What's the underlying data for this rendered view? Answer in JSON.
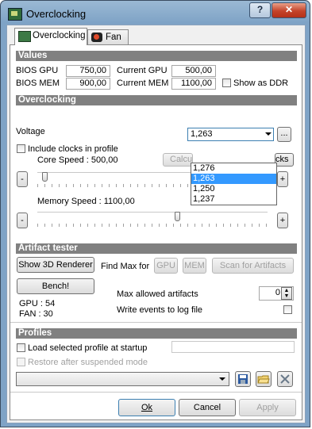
{
  "window": {
    "title": "Overclocking",
    "help_label": "?",
    "close_label": "✕"
  },
  "tabs": [
    {
      "label": "Overclocking",
      "icon": "board-icon"
    },
    {
      "label": "Fan",
      "icon": "fan-icon"
    }
  ],
  "values": {
    "header": "Values",
    "bios_gpu_label": "BIOS GPU",
    "bios_gpu": "750,00",
    "current_gpu_label": "Current GPU",
    "current_gpu": "500,00",
    "bios_mem_label": "BIOS MEM",
    "bios_mem": "900,00",
    "current_mem_label": "Current MEM",
    "current_mem": "1100,00",
    "show_ddr_label": "Show as DDR"
  },
  "overclocking": {
    "header": "Overclocking",
    "voltage_label": "Voltage",
    "voltage_value": "1,263",
    "voltage_options": [
      "1,276",
      "1,263",
      "1,250",
      "1,237"
    ],
    "voltage_more": "...",
    "include_clocks_label": "Include clocks in profile",
    "core_speed_label": "Core Speed : 500,00",
    "calc_button_partial": "Calcu",
    "clocks_button_partial": "cks",
    "minus": "-",
    "plus": "+",
    "memory_speed_label": "Memory Speed : 1100,00",
    "core_slider_fraction": 0.02,
    "memory_slider_fraction": 0.61
  },
  "artifact": {
    "header": "Artifact tester",
    "show_3d_label": "Show 3D Renderer",
    "bench_label": "Bench!",
    "find_max_label": "Find Max for",
    "gpu_btn": "GPU",
    "mem_btn": "MEM",
    "scan_btn": "Scan for Artifacts",
    "gpu_status": "GPU : 54",
    "fan_status": "FAN : 30",
    "max_allowed_label": "Max allowed artifacts",
    "max_allowed_value": "0",
    "write_log_label": "Write events to log file"
  },
  "profiles": {
    "header": "Profiles",
    "load_startup_label": "Load selected profile at startup",
    "restore_label": "Restore after suspended mode",
    "profile_text": "",
    "profile_selected": ""
  },
  "footer": {
    "ok_label": "Ok",
    "cancel_label": "Cancel",
    "apply_label": "Apply"
  }
}
